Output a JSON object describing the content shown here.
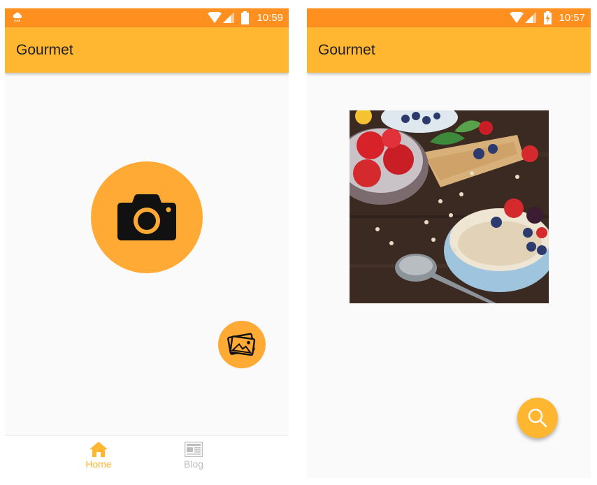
{
  "left_screen": {
    "status_bar": {
      "time": "10:59",
      "notification_icon": "cloud-rain-icon"
    },
    "app_bar": {
      "title": "Gourmet"
    },
    "main": {
      "camera_button_icon": "camera-icon",
      "gallery_button_icon": "photos-icon"
    },
    "bottom_nav": {
      "items": [
        {
          "label": "Home",
          "icon": "home-icon",
          "active": true
        },
        {
          "label": "Blog",
          "icon": "newspaper-icon",
          "active": false
        }
      ]
    }
  },
  "right_screen": {
    "status_bar": {
      "time": "10:57",
      "battery": "charging"
    },
    "app_bar": {
      "title": "Gourmet"
    },
    "main": {
      "image_subject": "bowls of oatmeal, berries and crackers on wooden table",
      "search_button_icon": "search-icon"
    }
  },
  "colors": {
    "status_bar": "#ff8f1f",
    "app_bar": "#ffb631",
    "accent": "#ffaa34",
    "inactive": "#bdbdbd"
  }
}
